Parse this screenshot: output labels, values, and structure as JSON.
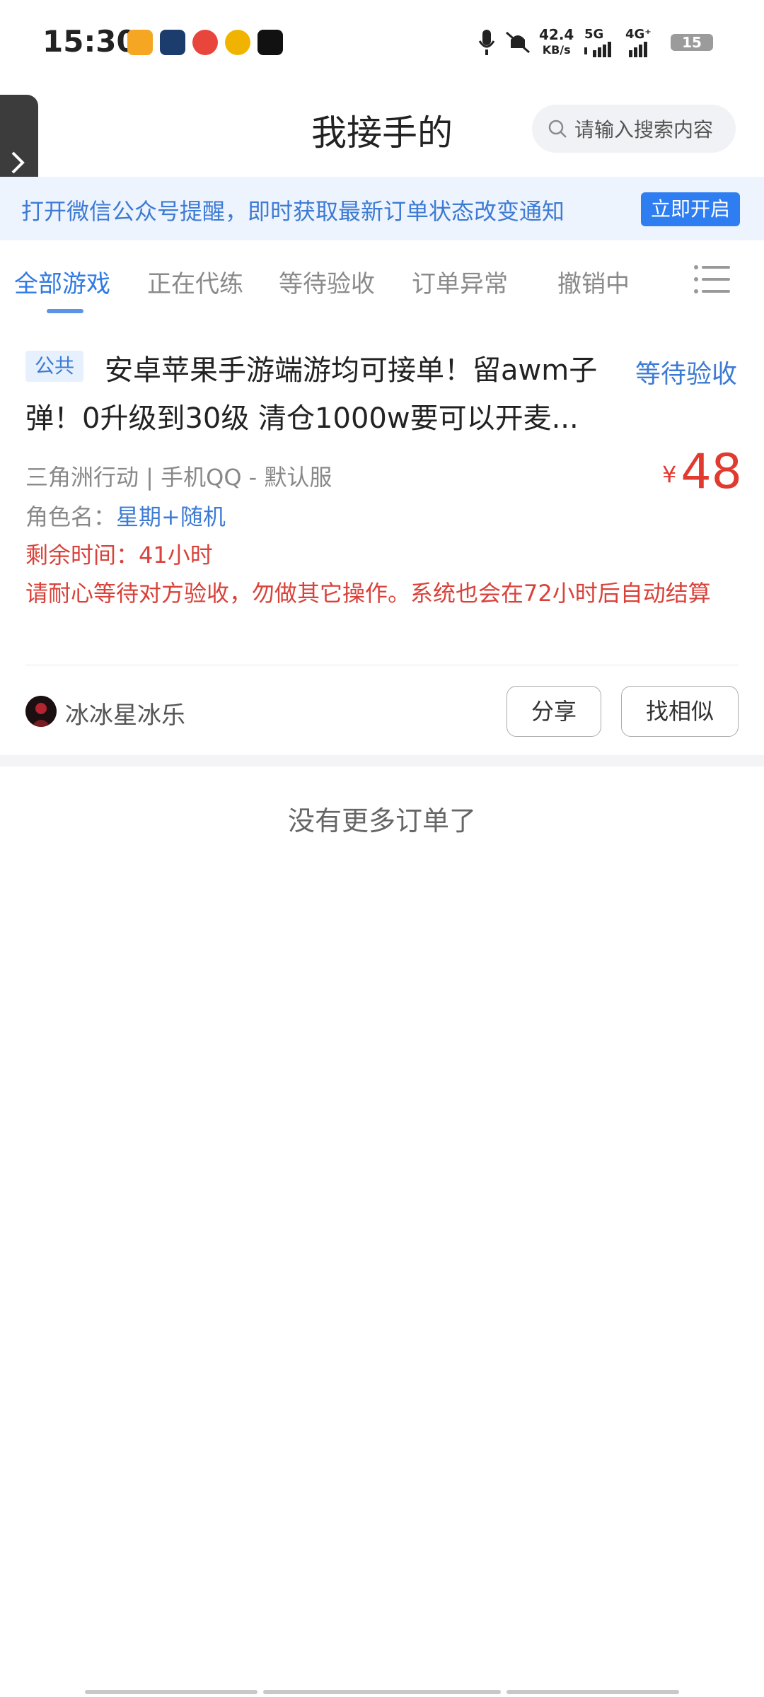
{
  "status_bar": {
    "time": "15:30",
    "net_speed": "42.4",
    "net_unit": "KB/s",
    "signal1": "5G",
    "signal2": "4G⁺",
    "battery": "15",
    "app_icon_colors": [
      "#f5a623",
      "#1d3c6e",
      "#e8453c",
      "#f0b400",
      "#111111"
    ]
  },
  "header": {
    "title": "我接手的",
    "search_placeholder": "请输入搜索内容"
  },
  "banner": {
    "text": "打开微信公众号提醒，即时获取最新订单状态改变通知",
    "button": "立即开启"
  },
  "tabs": [
    {
      "label": "全部游戏",
      "active": true
    },
    {
      "label": "正在代练",
      "active": false
    },
    {
      "label": "等待验收",
      "active": false
    },
    {
      "label": "订单异常",
      "active": false
    },
    {
      "label": "撤销中",
      "active": false
    }
  ],
  "order": {
    "tag": "公共",
    "title": "安卓苹果手游端游均可接单！留awm子弹！0升级到30级 清仓1000w要可以开麦...",
    "status": "等待验收",
    "game_server": "三角洲行动 | 手机QQ - 默认服",
    "price_currency": "¥",
    "price": "48",
    "role_label": "角色名：",
    "role_value": "星期+随机",
    "remaining_time": "剩余时间：41小时",
    "notice": "请耐心等待对方验收，勿做其它操作。系统也会在72小时后自动结算",
    "publisher": "冰冰星冰乐",
    "share_button": "分享",
    "similar_button": "找相似"
  },
  "footer_text": "没有更多订单了",
  "colors": {
    "accent_blue": "#2f7ae5",
    "price_red": "#e13a2f",
    "alert_red": "#d9423a"
  }
}
